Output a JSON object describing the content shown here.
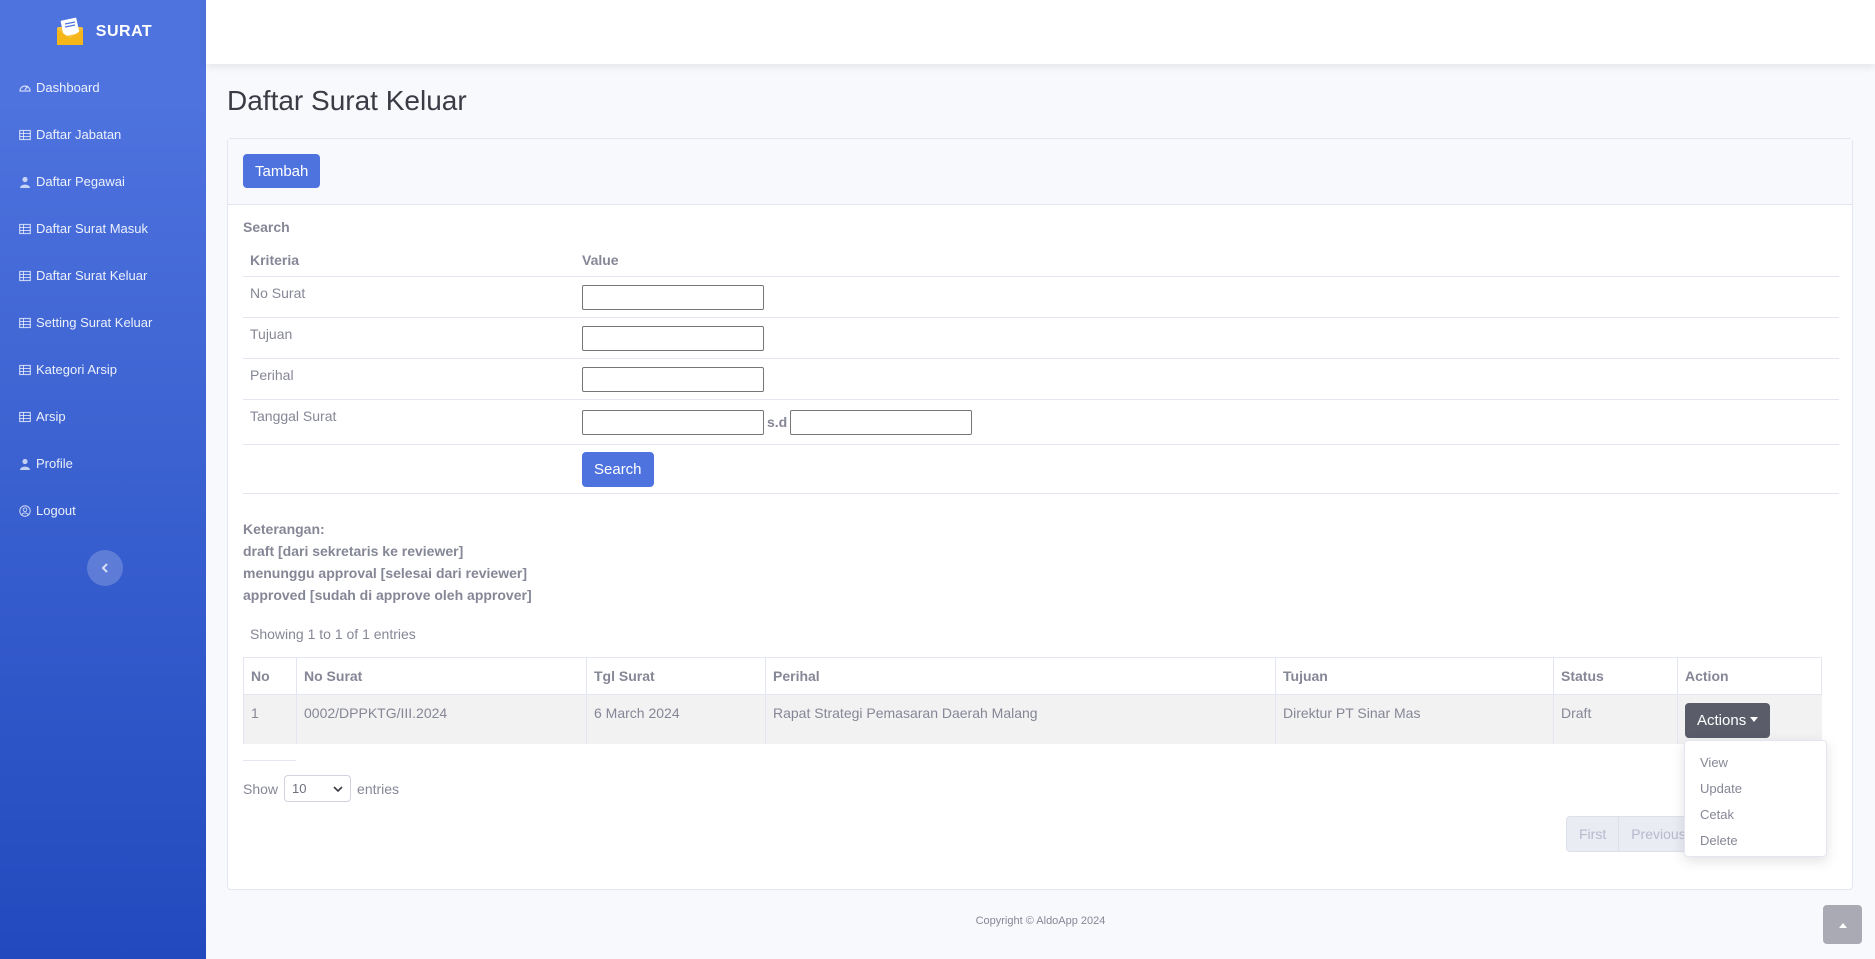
{
  "brand": {
    "name": "SURAT",
    "logo_icon": "envelope-letter-icon"
  },
  "sidebar": {
    "items": [
      {
        "label": "Dashboard",
        "icon": "tachometer-icon"
      },
      {
        "label": "Daftar Jabatan",
        "icon": "table-icon"
      },
      {
        "label": "Daftar Pegawai",
        "icon": "user-icon"
      },
      {
        "label": "Daftar Surat Masuk",
        "icon": "table-icon"
      },
      {
        "label": "Daftar Surat Keluar",
        "icon": "table-icon"
      },
      {
        "label": "Setting Surat Keluar",
        "icon": "table-icon"
      },
      {
        "label": "Kategori Arsip",
        "icon": "table-icon"
      },
      {
        "label": "Arsip",
        "icon": "table-icon"
      },
      {
        "label": "Profile",
        "icon": "user-icon"
      },
      {
        "label": "Logout",
        "icon": "user-circle-icon"
      }
    ],
    "toggle_icon": "chevron-left-icon"
  },
  "page": {
    "title": "Daftar Surat Keluar"
  },
  "card": {
    "add_button": "Tambah"
  },
  "search": {
    "title": "Search",
    "col_kriteria": "Kriteria",
    "col_value": "Value",
    "fields": {
      "no_surat": "No Surat",
      "tujuan": "Tujuan",
      "perihal": "Perihal",
      "tanggal_surat": "Tanggal Surat"
    },
    "range_sep": "s.d",
    "button": "Search"
  },
  "keterangan": {
    "title": "Keterangan:",
    "lines": [
      "draft [dari sekretaris ke reviewer]",
      "menunggu approval [selesai dari reviewer]",
      "approved [sudah di approve oleh approver]"
    ]
  },
  "table": {
    "info": "Showing 1 to 1 of 1 entries",
    "headers": [
      "No",
      "No Surat",
      "Tgl Surat",
      "Perihal",
      "Tujuan",
      "Status",
      "Action"
    ],
    "rows": [
      {
        "no": "1",
        "no_surat": "0002/DPPKTG/III.2024",
        "tgl": "6 March 2024",
        "perihal": "Rapat Strategi Pemasaran Daerah Malang",
        "tujuan": "Direktur PT Sinar Mas",
        "status": "Draft",
        "action": "Actions"
      }
    ],
    "show_label": "Show",
    "entries_label": "entries",
    "page_length": "10"
  },
  "pagination": {
    "first": "First",
    "previous": "Previous"
  },
  "actions_menu": [
    "View",
    "Update",
    "Cetak",
    "Delete"
  ],
  "footer": {
    "copyright": "Copyright © AldoApp 2024"
  },
  "colors": {
    "primary": "#4e73df",
    "sidebar_end": "#224abe",
    "secondary": "#5a5c69"
  }
}
